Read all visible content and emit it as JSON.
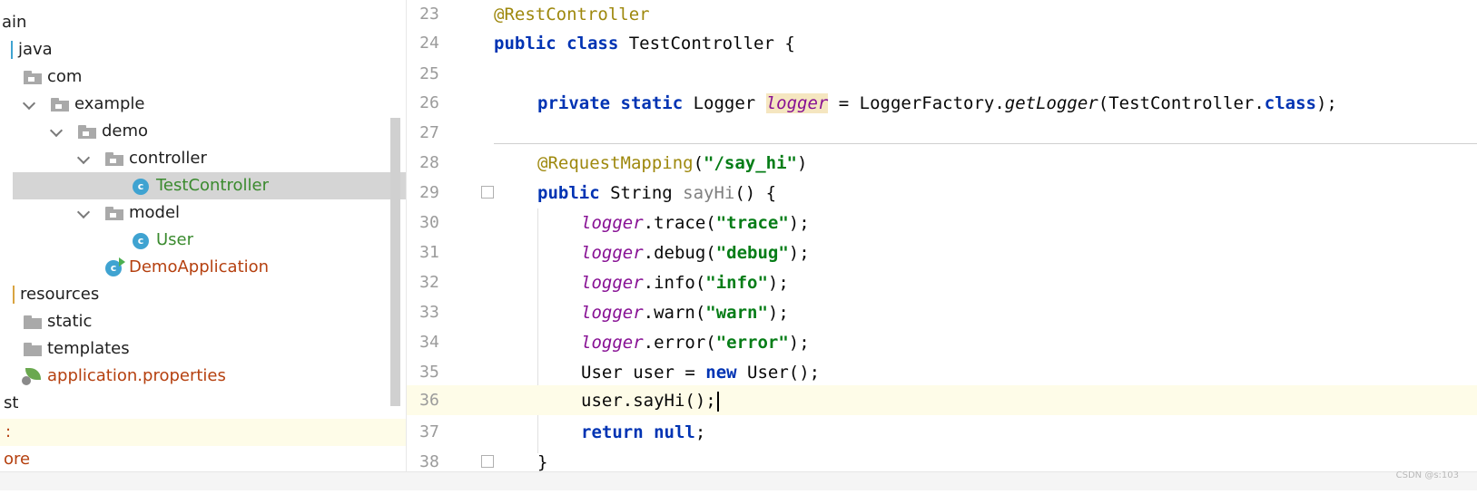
{
  "tree": {
    "items": [
      {
        "label": "ain",
        "color": "default"
      },
      {
        "label": "java",
        "color": "default"
      },
      {
        "label": "com",
        "color": "default"
      },
      {
        "label": "example",
        "color": "default"
      },
      {
        "label": "demo",
        "color": "default"
      },
      {
        "label": "controller",
        "color": "default"
      },
      {
        "label": "TestController",
        "color": "green",
        "selected": true
      },
      {
        "label": "model",
        "color": "default"
      },
      {
        "label": "User",
        "color": "green"
      },
      {
        "label": "DemoApplication",
        "color": "orange"
      },
      {
        "label": "resources",
        "color": "default"
      },
      {
        "label": "static",
        "color": "default"
      },
      {
        "label": "templates",
        "color": "default"
      },
      {
        "label": "application.properties",
        "color": "orange"
      },
      {
        "label": "st",
        "color": "default"
      },
      {
        "label": ":",
        "color": "orange",
        "current": true
      },
      {
        "label": "ore",
        "color": "orange"
      }
    ]
  },
  "editor": {
    "line_numbers": [
      "23",
      "24",
      "25",
      "26",
      "27",
      "28",
      "29",
      "30",
      "31",
      "32",
      "33",
      "34",
      "35",
      "36",
      "37",
      "38"
    ],
    "current_line": "36",
    "tokens": {
      "rest_controller": "@RestController",
      "public": "public",
      "class": "class",
      "test_controller_decl": " TestController {",
      "private": "private",
      "static": "static",
      "logger_type": " Logger ",
      "logger_field": "logger",
      "logger_factory": " = LoggerFactory.",
      "get_logger": "getLogger",
      "test_controller_arg": "(TestController.",
      "class_kw": "class",
      "close_semi": ");",
      "request_mapping": "@RequestMapping",
      "rm_open": "(",
      "path_str": "\"/say_hi\"",
      "rm_close": ")",
      "string_type": " String ",
      "say_hi_decl": "sayHi",
      "say_hi_sig": "() {",
      "trace_call": ".trace(",
      "trace_str": "\"trace\"",
      "debug_call": ".debug(",
      "debug_str": "\"debug\"",
      "info_call": ".info(",
      "info_str": "\"info\"",
      "warn_call": ".warn(",
      "warn_str": "\"warn\"",
      "error_call": ".error(",
      "error_str": "\"error\"",
      "user_decl": "User user = ",
      "new_kw": "new",
      "user_ctor": " User();",
      "user_call": "user.sayHi();",
      "return_kw": "return",
      "null_kw": "null",
      "semi": ";",
      "close_brace": "}"
    }
  },
  "watermark": "CSDN @s:103",
  "colors": {
    "keyword": "#0033b3",
    "annotation": "#9e880d",
    "string": "#067d17",
    "field": "#871094",
    "current_line": "#fefce8",
    "selection": "#d5d5d5"
  }
}
